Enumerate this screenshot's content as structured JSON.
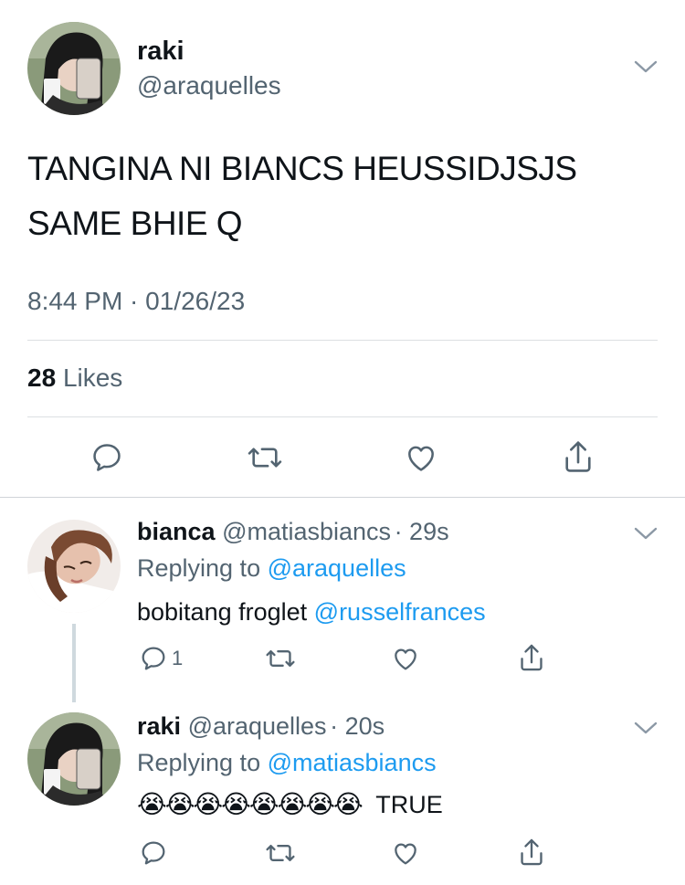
{
  "main_tweet": {
    "author_name": "raki",
    "author_handle": "@araquelles",
    "text_line1": "TANGINA NI BIANCS HEUSSIDJSJS",
    "text_line2": "SAME BHIE Q",
    "timestamp": "8:44 PM · 01/26/23",
    "likes_count": "28",
    "likes_label": "Likes"
  },
  "replies": [
    {
      "author_name": "bianca",
      "author_handle": "@matiasbiancs",
      "time": "· 29s",
      "replying_prefix": "Replying to",
      "replying_to": "@araquelles",
      "text": "bobitang froglet",
      "mention": "@russelfrances",
      "reply_count": "1"
    },
    {
      "author_name": "raki",
      "author_handle": "@araquelles",
      "time": "· 20s",
      "replying_prefix": "Replying to",
      "replying_to": "@matiasbiancs",
      "emoji": "😭😭😭😭😭😭😭😭",
      "text": "TRUE"
    }
  ],
  "colors": {
    "text": "#0f1419",
    "secondary": "#536471",
    "link": "#1d9bf0",
    "divider": "#dcdfe2"
  },
  "icons": [
    "chevron-down-icon",
    "reply-icon",
    "retweet-icon",
    "like-icon",
    "share-icon"
  ]
}
